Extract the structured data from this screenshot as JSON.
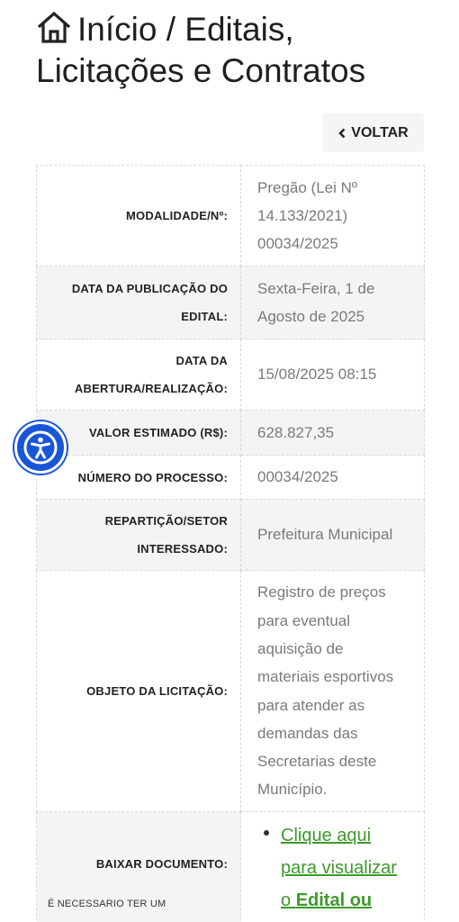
{
  "header": {
    "title": "Início / Editais, Licitações e Contratos",
    "home_icon": "home-icon"
  },
  "actions": {
    "back_label": "VOLTAR",
    "back_icon": "chevron-left-icon"
  },
  "details": [
    {
      "label": "MODALIDADE/Nº:",
      "value": "Pregão (Lei Nº 14.133/2021) 00034/2025"
    },
    {
      "label": "DATA DA PUBLICAÇÃO DO EDITAL:",
      "value": "Sexta-Feira, 1 de Agosto de 2025"
    },
    {
      "label": "DATA DA ABERTURA/REALIZAÇÃO:",
      "value": "15/08/2025 08:15"
    },
    {
      "label": "VALOR ESTIMADO (R$):",
      "value": "628.827,35"
    },
    {
      "label": "NÚMERO DO PROCESSO:",
      "value": "00034/2025"
    },
    {
      "label": "REPARTIÇÃO/SETOR INTERESSADO:",
      "value": "Prefeitura Municipal"
    },
    {
      "label": "OBJETO DA LICITAÇÃO:",
      "value": "Registro de preços para eventual aquisição de materiais esportivos para atender as demandas das Secretarias deste Município."
    }
  ],
  "download": {
    "label": "BAIXAR DOCUMENTO:",
    "note": "É NECESSARIO TER UM",
    "link_text": "Clique aqui para visualizar o ",
    "link_bold": "Edital ou"
  },
  "accessibility": {
    "icon": "accessibility-icon"
  },
  "colors": {
    "link": "#3d9a2a",
    "accessibility": "#1856d8",
    "row_alt": "#f4f4f4"
  }
}
